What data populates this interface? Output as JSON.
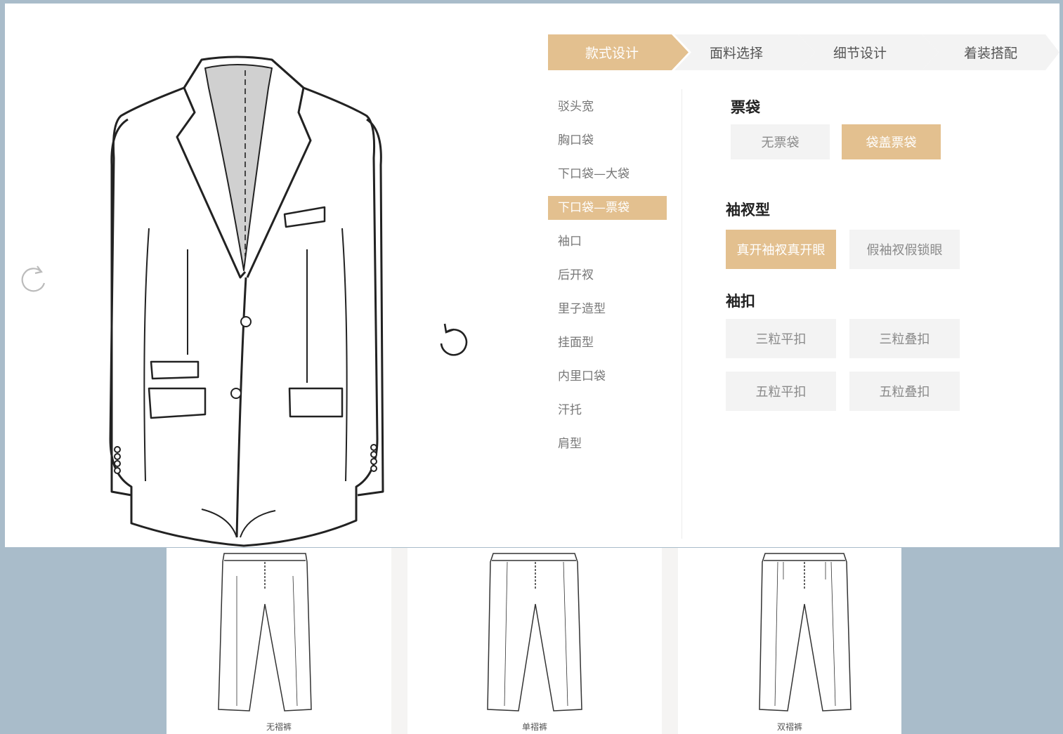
{
  "tabs": [
    {
      "label": "款式设计",
      "active": true
    },
    {
      "label": "面料选择",
      "active": false
    },
    {
      "label": "细节设计",
      "active": false
    },
    {
      "label": "着装搭配",
      "active": false
    }
  ],
  "side_nav": [
    {
      "label": "驳头宽"
    },
    {
      "label": "胸口袋"
    },
    {
      "label": "下口袋—大袋"
    },
    {
      "label": "下口袋—票袋",
      "active": true
    },
    {
      "label": "袖口"
    },
    {
      "label": "后开衩"
    },
    {
      "label": "里子造型"
    },
    {
      "label": "挂面型"
    },
    {
      "label": "内里口袋"
    },
    {
      "label": "汗托"
    },
    {
      "label": "肩型"
    }
  ],
  "sections": {
    "ticket_pocket": {
      "title": "票袋",
      "options": [
        {
          "label": "无票袋",
          "selected": false
        },
        {
          "label": "袋盖票袋",
          "selected": true
        }
      ]
    },
    "sleeve_vent": {
      "title": "袖衩型",
      "options": [
        {
          "label": "真开袖衩真开眼",
          "selected": true
        },
        {
          "label": "假袖衩假锁眼",
          "selected": false
        }
      ]
    },
    "sleeve_buttons": {
      "title": "袖扣",
      "options": [
        {
          "label": "三粒平扣",
          "selected": false
        },
        {
          "label": "三粒叠扣",
          "selected": false
        },
        {
          "label": "五粒平扣",
          "selected": false
        },
        {
          "label": "五粒叠扣",
          "selected": false
        }
      ]
    }
  },
  "pants": [
    {
      "label": "无褶裤"
    },
    {
      "label": "单褶裤"
    },
    {
      "label": "双褶裤"
    }
  ],
  "colors": {
    "accent": "#e3c08f",
    "background": "#a9bcca",
    "tab_inactive": "#f3f3f3"
  },
  "icons": {
    "rotate_left": "rotate-cw-icon",
    "rotate_right": "rotate-ccw-icon"
  }
}
